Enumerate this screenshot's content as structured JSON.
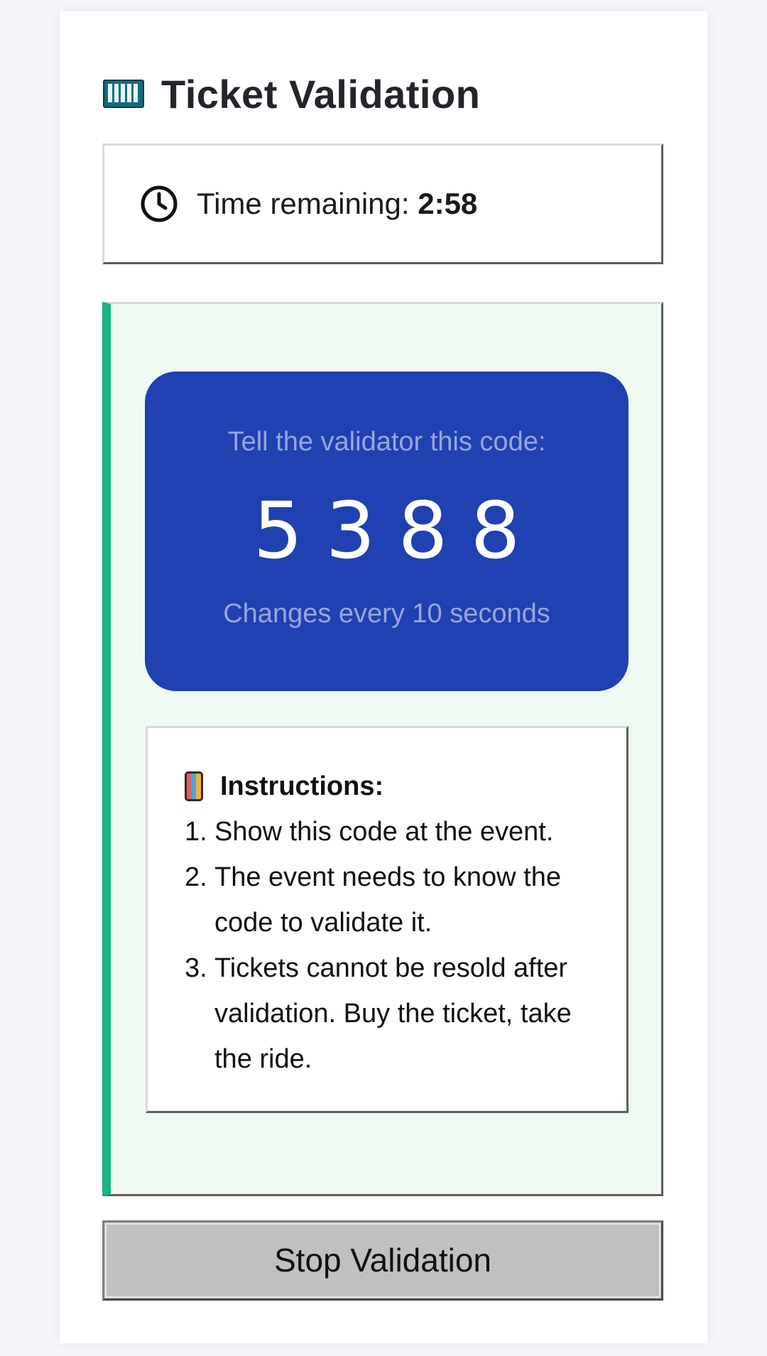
{
  "header": {
    "icon": "abacus-icon",
    "title": "Ticket Validation"
  },
  "timer": {
    "icon": "clock-icon",
    "label": "Time remaining: ",
    "value": "2:58"
  },
  "code_card": {
    "label": "Tell the validator this code:",
    "code": "5388",
    "note": "Changes every 10 seconds",
    "background": "#2041b1"
  },
  "instructions": {
    "icon": "mobile-phone-icon",
    "heading": "Instructions:",
    "items": [
      {
        "num": "1.",
        "text": "Show this code at the event."
      },
      {
        "num": "2.",
        "text": "The event needs to know the code to validate it."
      },
      {
        "num": "3.",
        "text": "Tickets cannot be resold after validation. Buy the ticket, take the ride."
      }
    ]
  },
  "actions": {
    "stop_label": "Stop Validation"
  },
  "colors": {
    "accent_border": "#18b486",
    "panel_background": "#eefaf2"
  }
}
